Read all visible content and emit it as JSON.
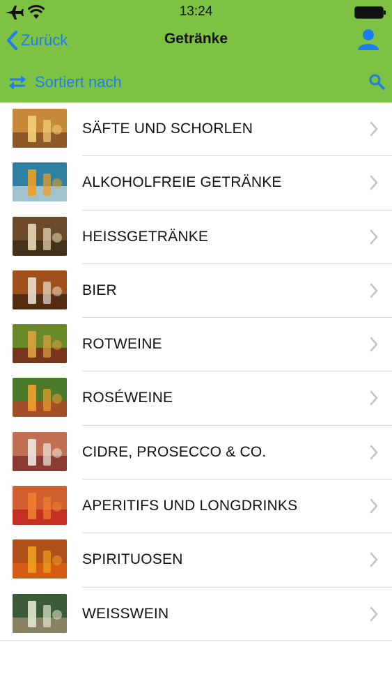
{
  "status_bar": {
    "time": "13:24"
  },
  "nav": {
    "back_label": "Zurück",
    "title": "Getränke"
  },
  "toolbar": {
    "sort_label": "Sortiert nach"
  },
  "colors": {
    "header_bg": "#7dc242",
    "accent": "#1e7df0"
  },
  "categories": [
    {
      "label": "SÄFTE UND SCHORLEN",
      "thumb_colors": [
        "#c9893a",
        "#f2d27a",
        "#7a4a22"
      ]
    },
    {
      "label": "ALKOHOLFREIE GETRÄNKE",
      "thumb_colors": [
        "#2f7fa0",
        "#f0a020",
        "#c8d8e0"
      ]
    },
    {
      "label": "HEISSGETRÄNKE",
      "thumb_colors": [
        "#6b4a2a",
        "#e8d8b8",
        "#3a2a1a"
      ]
    },
    {
      "label": "BIER",
      "thumb_colors": [
        "#a0501a",
        "#e8e0d0",
        "#3a2010"
      ]
    },
    {
      "label": "ROTWEINE",
      "thumb_colors": [
        "#6a8a2a",
        "#e0a040",
        "#7a1a1a"
      ]
    },
    {
      "label": "ROSÉWEINE",
      "thumb_colors": [
        "#4a7a2a",
        "#f0a030",
        "#c0402a"
      ]
    },
    {
      "label": "CIDRE, PROSECCO & CO.",
      "thumb_colors": [
        "#c07050",
        "#f0e8e0",
        "#7a2a2a"
      ]
    },
    {
      "label": "APERITIFS UND LONGDRINKS",
      "thumb_colors": [
        "#d06030",
        "#f08030",
        "#c02020"
      ]
    },
    {
      "label": "SPIRITUOSEN",
      "thumb_colors": [
        "#b0501a",
        "#f0a020",
        "#e06010"
      ]
    },
    {
      "label": "WEISSWEIN",
      "thumb_colors": [
        "#3a5a3a",
        "#e0e8d0",
        "#a09070"
      ]
    }
  ]
}
